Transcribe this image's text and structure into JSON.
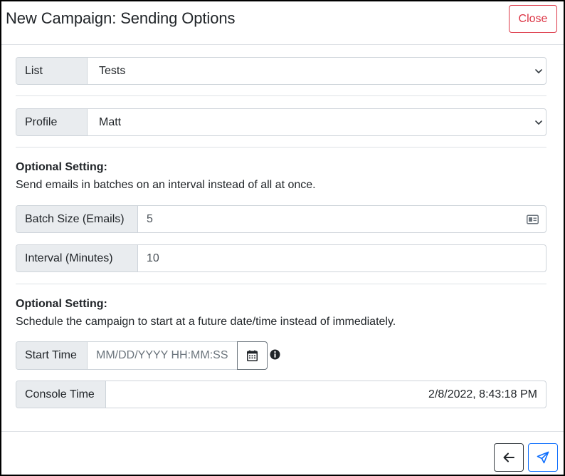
{
  "modal": {
    "title": "New Campaign: Sending Options",
    "close_label": "Close"
  },
  "list": {
    "label": "List",
    "selected": "Tests"
  },
  "profile": {
    "label": "Profile",
    "selected": "Matt"
  },
  "batching": {
    "heading": "Optional Setting:",
    "description": "Send emails in batches on an interval instead of all at once.",
    "batch_size_label": "Batch Size (Emails)",
    "batch_size_value": "5",
    "interval_label": "Interval (Minutes)",
    "interval_value": "10"
  },
  "schedule": {
    "heading": "Optional Setting:",
    "description": "Schedule the campaign to start at a future date/time instead of immediately.",
    "start_time_label": "Start Time",
    "start_time_placeholder": "MM/DD/YYYY HH:MM:SS",
    "console_time_label": "Console Time",
    "console_time_value": "2/8/2022, 8:43:18 PM"
  },
  "icons": {
    "chevron": "chevron-down-icon",
    "id_card": "id-card-icon",
    "calendar": "calendar-icon",
    "info": "info-circle-icon",
    "back": "arrow-left-icon",
    "send": "paper-plane-icon"
  },
  "colors": {
    "danger": "#dc3545",
    "primary": "#0d6efd",
    "addon_bg": "#e9ecef",
    "border": "#ced4da"
  }
}
